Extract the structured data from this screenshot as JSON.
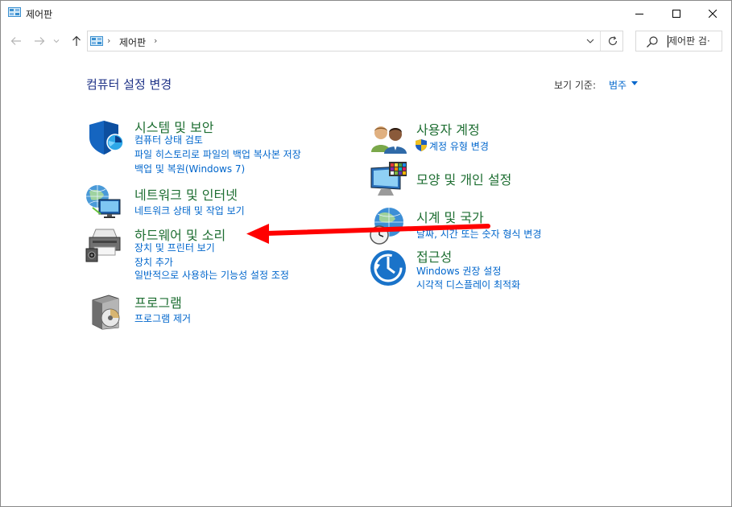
{
  "window": {
    "title": "제어판"
  },
  "navbar": {
    "breadcrumb": "제어판",
    "sep": "›",
    "search_placeholder": "제어판 검·"
  },
  "main": {
    "title": "컴퓨터 설정 변경",
    "view_by_label": "보기 기준:",
    "view_by_value": "범주"
  },
  "categories": {
    "system": {
      "title": "시스템 및 보안",
      "links": [
        "컴퓨터 상태 검토",
        "파일 히스토리로 파일의 백업 복사본 저장",
        "백업 및 복원(Windows 7)"
      ]
    },
    "network": {
      "title": "네트워크 및 인터넷",
      "links": [
        "네트워크 상태 및 작업 보기"
      ]
    },
    "hardware": {
      "title": "하드웨어 및 소리",
      "links": [
        "장치 및 프린터 보기",
        "장치 추가",
        "일반적으로 사용하는 기능성 설정 조정"
      ]
    },
    "programs": {
      "title": "프로그램",
      "links": [
        "프로그램 제거"
      ]
    },
    "users": {
      "title": "사용자 계정",
      "links": [
        "계정 유형 변경"
      ]
    },
    "appearance": {
      "title": "모양 및 개인 설정",
      "links": []
    },
    "clock": {
      "title": "시계 및 국가",
      "links": [
        "날짜, 시간 또는 숫자 형식 변경"
      ]
    },
    "access": {
      "title": "접근성",
      "links": [
        "Windows 권장 설정",
        "시각적 디스플레이 최적화"
      ]
    }
  },
  "colors": {
    "category_title": "#1e6e32",
    "link": "#0066cc",
    "heading": "#1e3287",
    "annotation_arrow": "#ff0000"
  }
}
